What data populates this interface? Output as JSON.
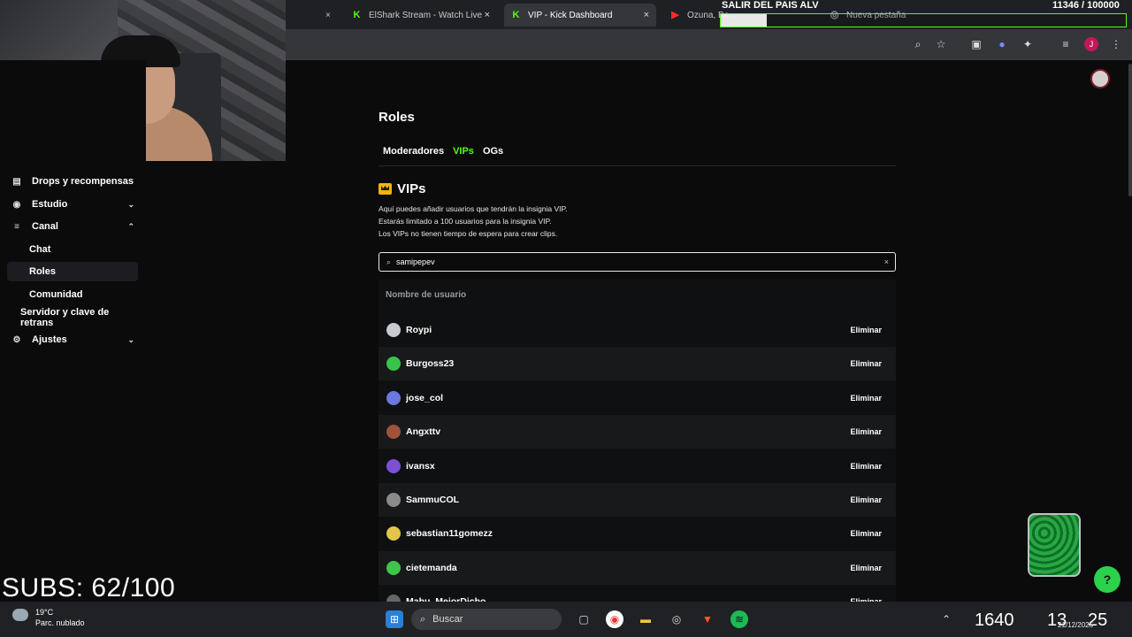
{
  "browser": {
    "tabs": [
      {
        "label": "ElShark Stream - Watch Live",
        "active": false
      },
      {
        "label": "VIP - Kick Dashboard",
        "active": true
      },
      {
        "label": "Ozuna, Be...",
        "active": false
      },
      {
        "label": "Nueva pestaña",
        "active": false
      }
    ]
  },
  "overlay": {
    "goal_title": "SALIR DEL PAIS ALV",
    "goal_count": "11346 / 100000",
    "goal_fraction": 0.11346,
    "subs": "SUBS: 62/100"
  },
  "sidebar": {
    "items": [
      {
        "label": "Drops y recompensas",
        "icon": "gift-icon",
        "chevron": ""
      },
      {
        "label": "Estudio",
        "icon": "studio-icon",
        "chevron": "down"
      },
      {
        "label": "Canal",
        "icon": "channel-icon",
        "chevron": "up"
      },
      {
        "label": "Chat",
        "sub": true
      },
      {
        "label": "Roles",
        "sub": true,
        "selected": true
      },
      {
        "label": "Comunidad",
        "sub": true
      },
      {
        "label": "Servidor y clave de retrans",
        "sub": false
      },
      {
        "label": "Ajustes",
        "icon": "gear-icon",
        "chevron": "down"
      }
    ]
  },
  "main": {
    "title": "Roles",
    "tabs": [
      "Moderadores",
      "VIPs",
      "OGs"
    ],
    "active_tab": "VIPs",
    "section_title": "VIPs",
    "description": [
      "Aquí puedes añadir usuarios que tendrán la insignia VIP.",
      "Estarás limitado a 100 usuarios para la insignia VIP.",
      "Los VIPs no tienen tiempo de espera para crear clips."
    ],
    "search_value": "samipepev",
    "column_header": "Nombre de usuario",
    "remove_label": "Eliminar",
    "users": [
      {
        "name": "Roypi",
        "avatar_color": "#c9c9d0"
      },
      {
        "name": "Burgoss23",
        "avatar_color": "#37c44a"
      },
      {
        "name": "jose_col",
        "avatar_color": "#6a78e0"
      },
      {
        "name": "Angxttv",
        "avatar_color": "#a0523b"
      },
      {
        "name": "ivansx",
        "avatar_color": "#7d4fd6"
      },
      {
        "name": "SammuCOL",
        "avatar_color": "#8a8a8a"
      },
      {
        "name": "sebastian11gomezz",
        "avatar_color": "#e4c44a"
      },
      {
        "name": "cietemanda",
        "avatar_color": "#3ec54a"
      },
      {
        "name": "Mahu_MejorDicho",
        "avatar_color": "#666"
      }
    ]
  },
  "taskbar": {
    "search_placeholder": "Buscar",
    "weather_temp": "19°C",
    "weather_desc": "Parc. nublado",
    "clock_a": "1640",
    "clock_b": "13",
    "clock_c": "25",
    "date_small": "21/12/2025"
  },
  "colors": {
    "accent": "#53fc18",
    "background": "#0b0b0c"
  }
}
